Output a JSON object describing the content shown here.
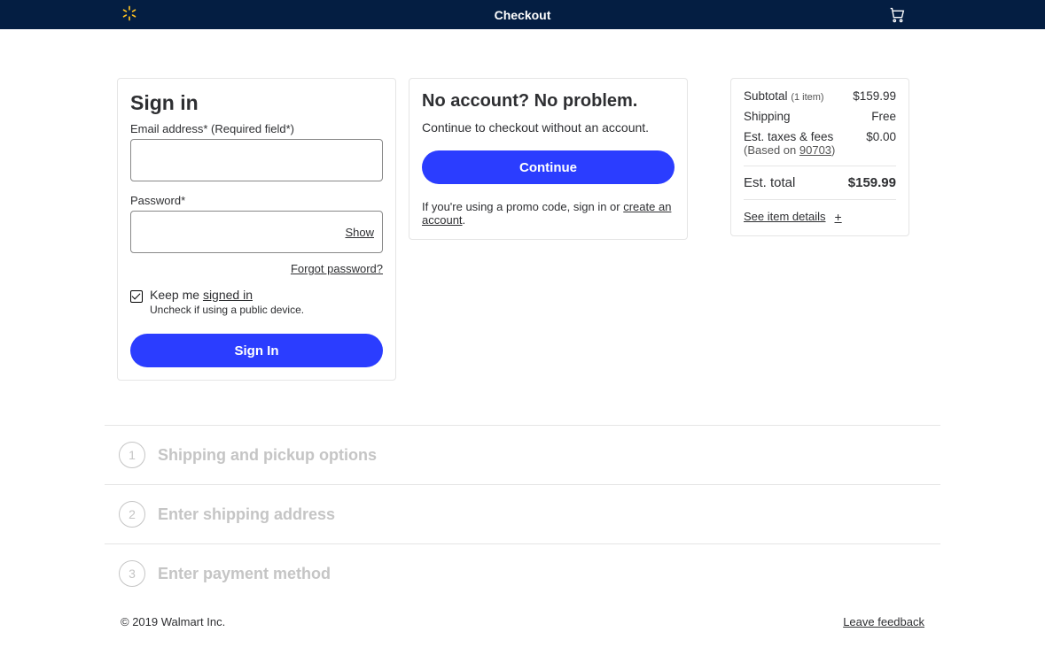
{
  "header": {
    "title": "Checkout"
  },
  "signin": {
    "heading": "Sign in",
    "email_label": "Email address* (Required field*)",
    "password_label": "Password*",
    "show_label": "Show",
    "forgot": "Forgot password?",
    "keep_prefix": "Keep me ",
    "keep_link": "signed in",
    "keep_sub": "Uncheck if using a public device.",
    "button": "Sign In"
  },
  "guest": {
    "heading": "No account? No problem.",
    "subtext": "Continue to checkout without an account.",
    "button": "Continue",
    "promo_prefix": "If you're using a promo code, sign in or ",
    "promo_link": "create an account",
    "promo_suffix": "."
  },
  "summary": {
    "subtotal_label": "Subtotal",
    "subtotal_count": "(1 item)",
    "subtotal_value": "$159.99",
    "shipping_label": "Shipping",
    "shipping_value": "Free",
    "tax_label": "Est. taxes & fees",
    "tax_note_prefix": "(Based on ",
    "tax_zip": "90703",
    "tax_note_suffix": ")",
    "tax_value": "$0.00",
    "total_label": "Est. total",
    "total_value": "$159.99",
    "details": "See item details"
  },
  "steps": [
    {
      "num": "1",
      "title": "Shipping and pickup options"
    },
    {
      "num": "2",
      "title": "Enter shipping address"
    },
    {
      "num": "3",
      "title": "Enter payment method"
    }
  ],
  "footer": {
    "copyright": "© 2019 Walmart Inc.",
    "feedback": "Leave feedback"
  }
}
